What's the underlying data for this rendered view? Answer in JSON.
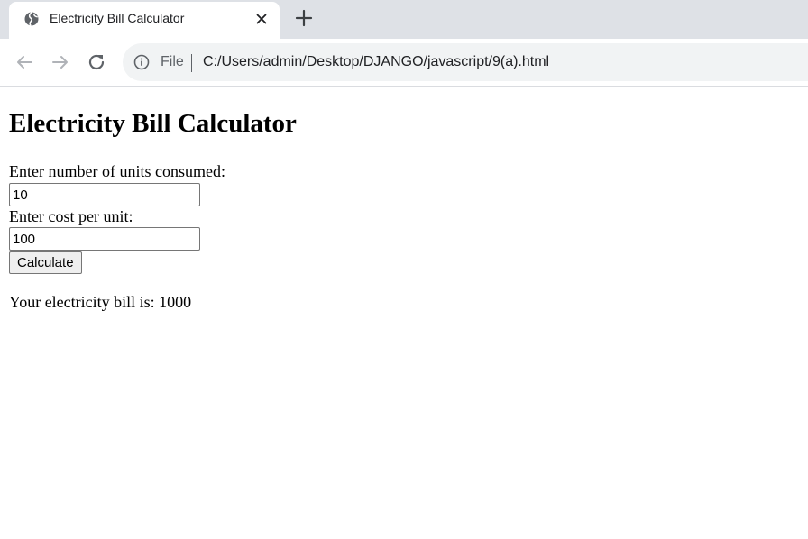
{
  "browser": {
    "tab": {
      "title": "Electricity Bill Calculator",
      "favicon": "globe-icon"
    },
    "toolbar": {
      "back": "back-arrow-icon",
      "forward": "forward-arrow-icon",
      "reload": "reload-icon"
    },
    "omnibox": {
      "scheme_label": "File",
      "url": "C:/Users/admin/Desktop/DJANGO/javascript/9(a).html"
    }
  },
  "page": {
    "heading": "Electricity Bill Calculator",
    "units_label": "Enter number of units consumed:",
    "units_value": "10",
    "cost_label": "Enter cost per unit:",
    "cost_value": "100",
    "calculate_label": "Calculate",
    "result_text": "Your electricity bill is: 1000"
  }
}
